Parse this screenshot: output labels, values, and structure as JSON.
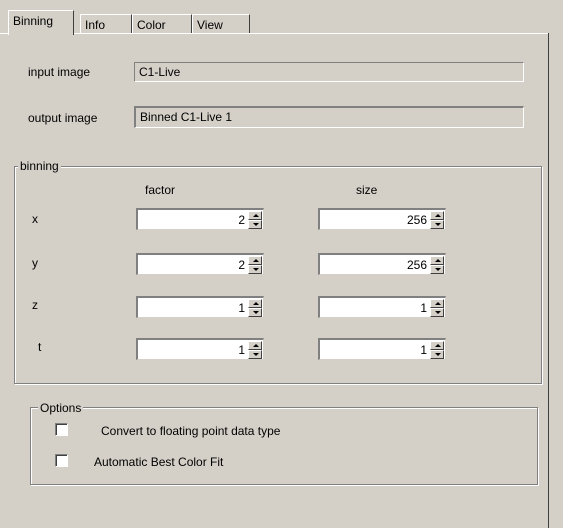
{
  "tabs": [
    {
      "label": "Binning",
      "active": true
    },
    {
      "label": "Info",
      "active": false
    },
    {
      "label": "Color",
      "active": false
    },
    {
      "label": "View",
      "active": false
    }
  ],
  "images": {
    "input_label": "input  image",
    "input_value": "C1-Live",
    "output_label": "output image",
    "output_value": "Binned C1-Live 1"
  },
  "binning": {
    "title": "binning",
    "factor_header": "factor",
    "size_header": "size",
    "rows": [
      {
        "axis": "x",
        "factor": "2",
        "size": "256"
      },
      {
        "axis": "y",
        "factor": "2",
        "size": "256"
      },
      {
        "axis": "z",
        "factor": "1",
        "size": "1"
      },
      {
        "axis": "t",
        "factor": "1",
        "size": "1"
      }
    ]
  },
  "options": {
    "title": "Options",
    "convert_label": "Convert to floating point data type",
    "convert_checked": false,
    "autofit_label": "Automatic Best Color Fit",
    "autofit_checked": false
  }
}
